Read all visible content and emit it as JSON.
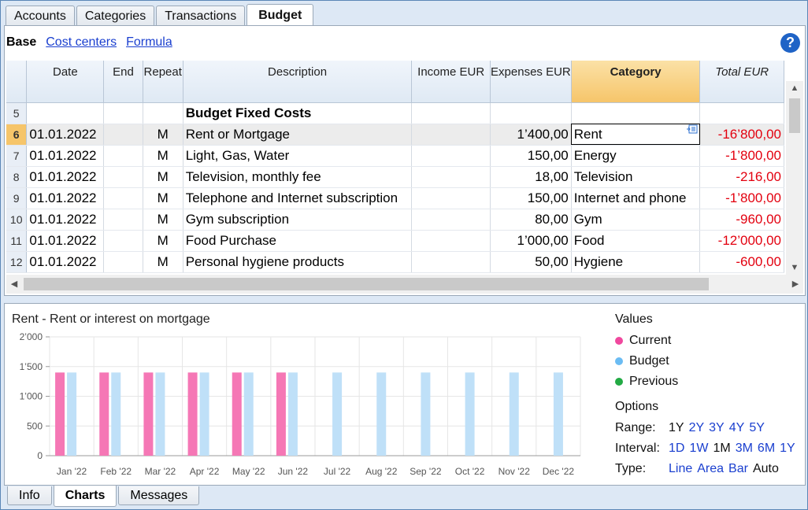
{
  "top_tabs": [
    "Accounts",
    "Categories",
    "Transactions",
    "Budget"
  ],
  "active_top_tab": "Budget",
  "views": {
    "active": "Base",
    "links": [
      "Cost centers",
      "Formula"
    ]
  },
  "help_label": "?",
  "columns": [
    "Date",
    "End",
    "Repeat",
    "Description",
    "Income EUR",
    "Expenses EUR",
    "Category",
    "Total EUR"
  ],
  "rows": [
    {
      "n": "5",
      "date": "",
      "end": "",
      "repeat": "",
      "desc": "Budget Fixed Costs",
      "income": "",
      "expenses": "",
      "category": "",
      "total": "",
      "heading": true
    },
    {
      "n": "6",
      "date": "01.01.2022",
      "end": "",
      "repeat": "M",
      "desc": "Rent or Mortgage",
      "income": "",
      "expenses": "1’400,00",
      "category": "Rent",
      "total": "-16’800,00",
      "selected": true
    },
    {
      "n": "7",
      "date": "01.01.2022",
      "end": "",
      "repeat": "M",
      "desc": "Light, Gas, Water",
      "income": "",
      "expenses": "150,00",
      "category": "Energy",
      "total": "-1’800,00"
    },
    {
      "n": "8",
      "date": "01.01.2022",
      "end": "",
      "repeat": "M",
      "desc": "Television, monthly fee",
      "income": "",
      "expenses": "18,00",
      "category": "Television",
      "total": "-216,00"
    },
    {
      "n": "9",
      "date": "01.01.2022",
      "end": "",
      "repeat": "M",
      "desc": "Telephone and Internet subscription",
      "income": "",
      "expenses": "150,00",
      "category": "Internet and phone",
      "total": "-1’800,00"
    },
    {
      "n": "10",
      "date": "01.01.2022",
      "end": "",
      "repeat": "M",
      "desc": "Gym subscription",
      "income": "",
      "expenses": "80,00",
      "category": "Gym",
      "total": "-960,00"
    },
    {
      "n": "11",
      "date": "01.01.2022",
      "end": "",
      "repeat": "M",
      "desc": "Food Purchase",
      "income": "",
      "expenses": "1’000,00",
      "category": "Food",
      "total": "-12’000,00"
    },
    {
      "n": "12",
      "date": "01.01.2022",
      "end": "",
      "repeat": "M",
      "desc": "Personal hygiene products",
      "income": "",
      "expenses": "50,00",
      "category": "Hygiene",
      "total": "-600,00"
    }
  ],
  "chart_panel": {
    "title": "Rent - Rent or interest on mortgage",
    "values_heading": "Values",
    "legend": [
      {
        "label": "Current",
        "color": "#f0489e"
      },
      {
        "label": "Budget",
        "color": "#6bbcf3"
      },
      {
        "label": "Previous",
        "color": "#22aa44"
      }
    ],
    "options_heading": "Options",
    "options": [
      {
        "label": "Range:",
        "choices": [
          "1Y",
          "2Y",
          "3Y",
          "4Y",
          "5Y"
        ],
        "current": "1Y"
      },
      {
        "label": "Interval:",
        "choices": [
          "1D",
          "1W",
          "1M",
          "3M",
          "6M",
          "1Y"
        ],
        "current": "1M"
      },
      {
        "label": "Type:",
        "choices": [
          "Line",
          "Area",
          "Bar",
          "Auto"
        ],
        "current": "Auto"
      }
    ]
  },
  "chart_data": {
    "type": "bar",
    "title": "Rent - Rent or interest on mortgage",
    "categories": [
      "Jan '22",
      "Feb '22",
      "Mar '22",
      "Apr '22",
      "May '22",
      "Jun '22",
      "Jul '22",
      "Aug '22",
      "Sep '22",
      "Oct '22",
      "Nov '22",
      "Dec '22"
    ],
    "series": [
      {
        "name": "Current",
        "color": "#f577b5",
        "values": [
          1400,
          1400,
          1400,
          1400,
          1400,
          1400,
          null,
          null,
          null,
          null,
          null,
          null
        ]
      },
      {
        "name": "Budget",
        "color": "#bfe0f8",
        "values": [
          1400,
          1400,
          1400,
          1400,
          1400,
          1400,
          1400,
          1400,
          1400,
          1400,
          1400,
          1400
        ]
      }
    ],
    "yticks": [
      "0",
      "500",
      "1’000",
      "1’500",
      "2’000"
    ],
    "ylim": [
      0,
      2000
    ],
    "grid": true,
    "legend": "right"
  },
  "bottom_tabs": [
    "Info",
    "Charts",
    "Messages"
  ],
  "active_bottom_tab": "Charts"
}
